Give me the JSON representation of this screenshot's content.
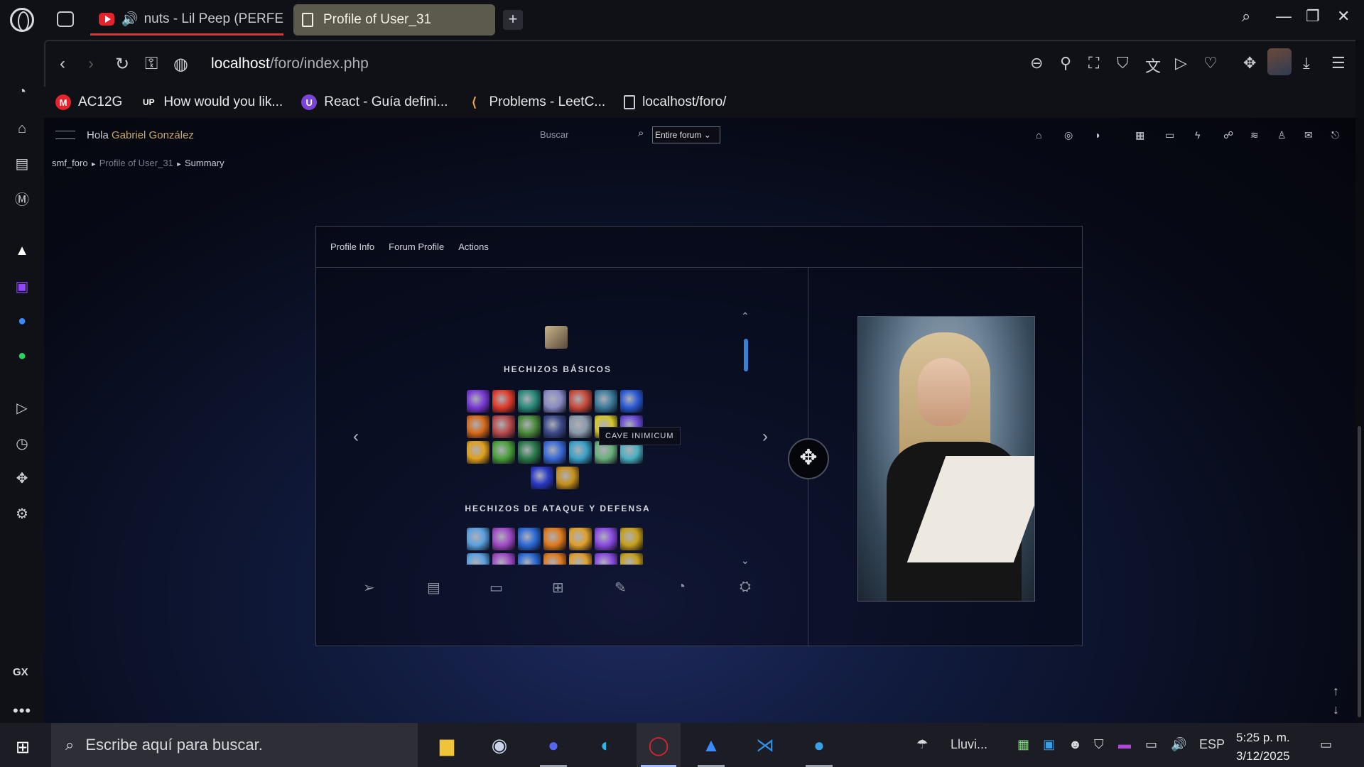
{
  "browser": {
    "tabs": [
      {
        "label": "nuts - Lil Peep (PERFE",
        "audio": true
      },
      {
        "label": "Profile of User_31",
        "active": true
      }
    ],
    "url_host": "localhost",
    "url_path": "/foro/index.php",
    "bookmarks": [
      {
        "label": "AC12G",
        "icon": "M",
        "color": "#e4232c"
      },
      {
        "label": "How would you lik...",
        "icon": "UP",
        "color": "#1b1c24"
      },
      {
        "label": "React - Guía defini...",
        "icon": "U",
        "color": "#7a45d6"
      },
      {
        "label": "Problems - LeetC...",
        "icon": "leetcode-icon",
        "color": "#f0a23c"
      },
      {
        "label": "localhost/foro/",
        "icon": "doc-icon",
        "color": "#c9ccd4"
      }
    ],
    "sidebar_label": "GX",
    "sidebar_more": "•••"
  },
  "forum": {
    "greeting": "Hola",
    "username": "Gabriel González",
    "search_placeholder": "Buscar",
    "search_scope": "Entire forum",
    "breadcrumb": [
      "smf_foro",
      "Profile of User_31",
      "Summary"
    ],
    "breadcrumb_sep": "►"
  },
  "profile": {
    "tabs": [
      "Profile Info",
      "Forum Profile",
      "Actions"
    ],
    "section_basic": "HECHIZOS BÁSICOS",
    "section_attack": "HECHIZOS DE ATAQUE Y DEFENSA",
    "tooltip": "CAVE INIMICUM",
    "basic_spell_colors": [
      "#7a3ad6",
      "#e03a2a",
      "#2a8a7a",
      "#8a8ac6",
      "#c84a3a",
      "#3a7a9a",
      "#2a5ad6",
      "#d66a1a",
      "#b84a4a",
      "#4a8a3a",
      "#3a4a8a",
      "#8a9aaa",
      "#d6c62a",
      "#6a4ad6",
      "#e0a01a",
      "#4aa03a",
      "#2a7a4a",
      "#3a6ad6",
      "#3aa0c6",
      "#6ab07a",
      "#4ab0c0"
    ],
    "extra_spell_colors": [
      "#2a3ac6",
      "#c6901a"
    ],
    "attack_spell_colors": [
      "#5aa0e0",
      "#a04ac6",
      "#2a6ad6",
      "#e07a1a",
      "#e0a02a",
      "#8a4ae0",
      "#c6a01a"
    ]
  },
  "taskbar": {
    "search_placeholder": "Escribe aquí para buscar.",
    "weather": "Lluvi...",
    "language": "ESP",
    "time": "5:25 p. m.",
    "date": "3/12/2025"
  }
}
